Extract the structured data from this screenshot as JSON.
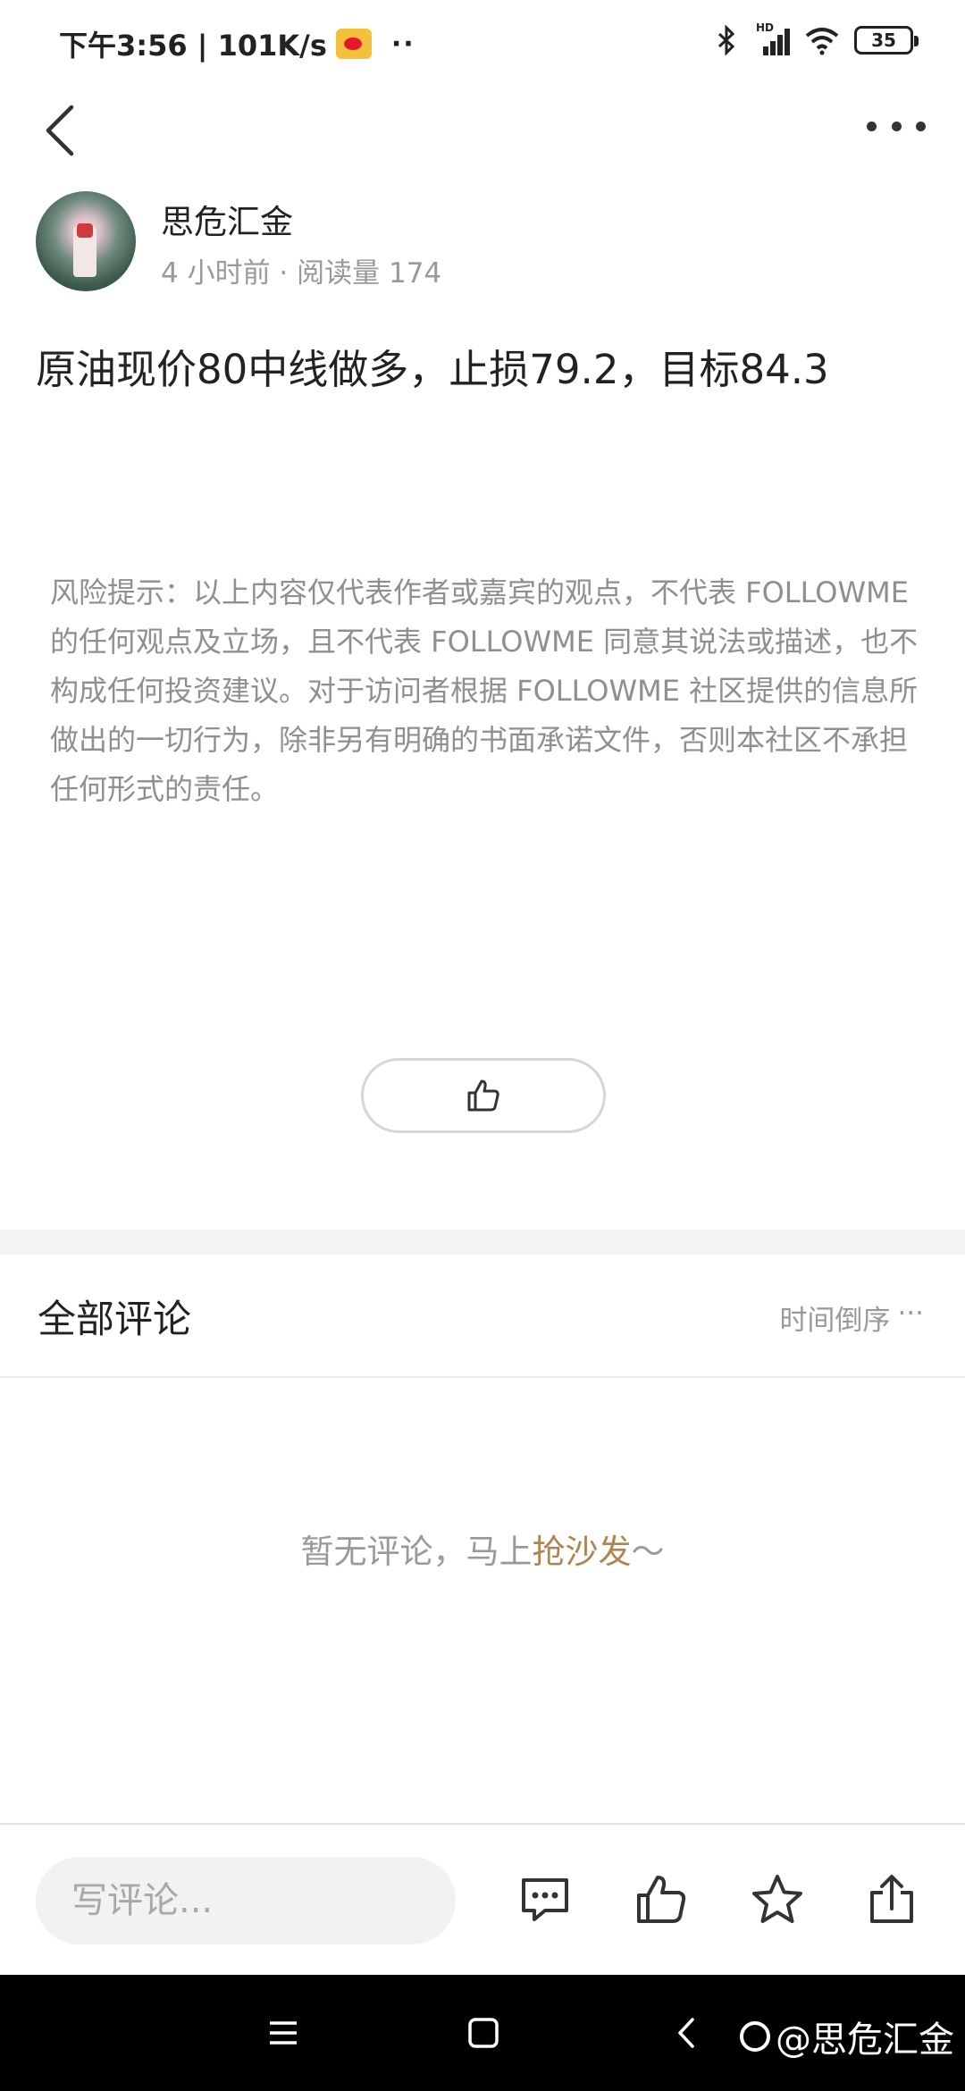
{
  "status_bar": {
    "time_speed": "下午3:56 | 101K/s",
    "more_dots": "··",
    "battery": "35",
    "network_badge": "HD"
  },
  "author": {
    "name": "思危汇金",
    "meta": "4 小时前 · 阅读量 174"
  },
  "post": {
    "title": "原油现价80中线做多，止损79.2，目标84.3",
    "risk_notice": "风险提示：以上内容仅代表作者或嘉宾的观点，不代表 FOLLOWME 的任何观点及立场，且不代表 FOLLOWME 同意其说法或描述，也不构成任何投资建议。对于访问者根据 FOLLOWME 社区提供的信息所做出的一切行为，除非另有明确的书面承诺文件，否则本社区不承担任何形式的责任。"
  },
  "comments": {
    "heading": "全部评论",
    "sort_label": "时间倒序",
    "sort_more": "···",
    "empty_prefix": "暂无评论，马上",
    "empty_link": "抢沙发",
    "empty_suffix": "～"
  },
  "bottom_bar": {
    "input_placeholder": "写评论..."
  },
  "watermark": {
    "text": "@思危汇金"
  },
  "colors": {
    "link_accent": "#b0844f",
    "muted_text": "#999999",
    "nav_bar": "#000000"
  }
}
